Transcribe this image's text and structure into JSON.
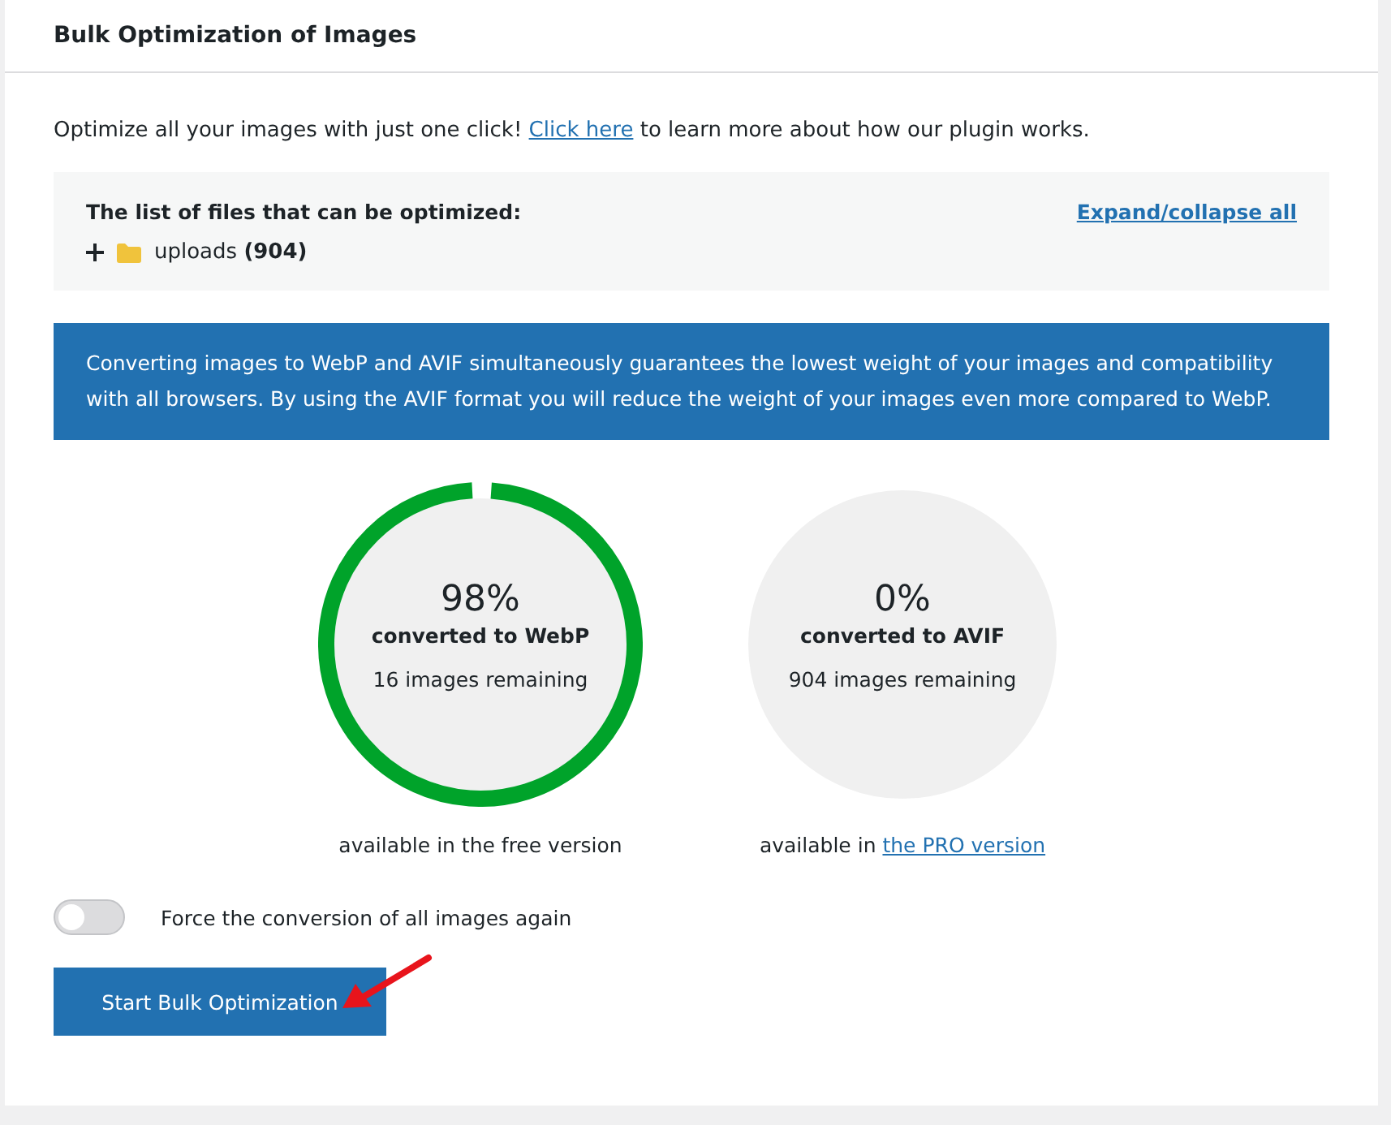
{
  "header": {
    "title": "Bulk Optimization of Images"
  },
  "intro": {
    "before": "Optimize all your images with just one click!",
    "link": "Click here",
    "after": "to learn more about how our plugin works."
  },
  "file_list": {
    "title": "The list of files that can be optimized:",
    "toggle_all": "Expand/collapse all",
    "items": [
      {
        "name": "uploads **(904)**",
        "expanded": false
      }
    ]
  },
  "notice": "Converting images to WebP and AVIF simultaneously guarantees the lowest weight of your images and compatibility with all browsers. By using the AVIF format you will reduce the weight of your images even more compared to WebP.",
  "stats": [
    {
      "percent": "98%",
      "label": "converted to WebP",
      "remaining": "16 images remaining",
      "level": 0.98,
      "availability": {
        "before": "available in the free version"
      }
    },
    {
      "percent": "0%",
      "label": "converted to AVIF",
      "remaining": "904 images remaining",
      "availability": {
        "before": "available in",
        "link": "the PRO version"
      }
    }
  ],
  "force_toggle": {
    "label": "Force the conversion of all images again",
    "on": false
  },
  "start_button": {
    "label": "Start Bulk Optimization"
  }
}
